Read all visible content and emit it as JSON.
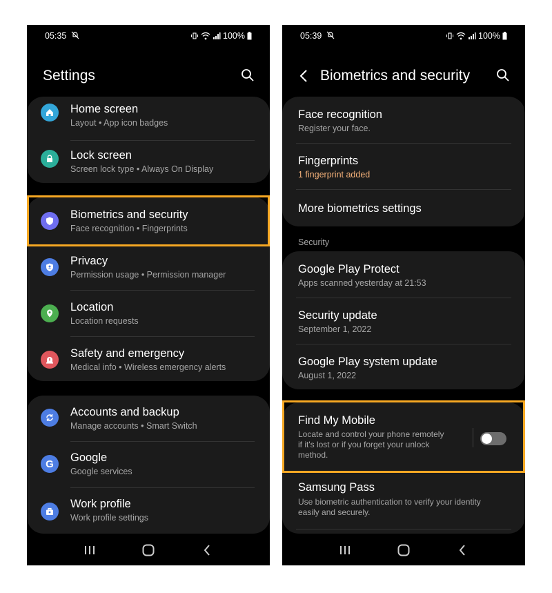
{
  "left": {
    "status": {
      "time": "05:35",
      "battery": "100%"
    },
    "title": "Settings",
    "groups": [
      [
        {
          "title": "Home screen",
          "subtitle": "Layout  •  App icon badges",
          "icon": "home-icon",
          "color": "#33a6d9"
        },
        {
          "title": "Lock screen",
          "subtitle": "Screen lock type  •  Always On Display",
          "icon": "lock-icon",
          "color": "#2bae9a"
        }
      ],
      [
        {
          "title": "Biometrics and security",
          "subtitle": "Face recognition  •  Fingerprints",
          "icon": "shield-icon",
          "color": "#6f6ef0"
        },
        {
          "title": "Privacy",
          "subtitle": "Permission usage  •  Permission manager",
          "icon": "privacy-icon",
          "color": "#4d7de3"
        },
        {
          "title": "Location",
          "subtitle": "Location requests",
          "icon": "location-pin-icon",
          "color": "#4caf50"
        },
        {
          "title": "Safety and emergency",
          "subtitle": "Medical info  •  Wireless emergency alerts",
          "icon": "emergency-icon",
          "color": "#e0575d"
        }
      ],
      [
        {
          "title": "Accounts and backup",
          "subtitle": "Manage accounts  •  Smart Switch",
          "icon": "sync-icon",
          "color": "#4d7de3"
        },
        {
          "title": "Google",
          "subtitle": "Google services",
          "icon": "google-icon",
          "color": "#4d7de3"
        },
        {
          "title": "Work profile",
          "subtitle": "Work profile settings",
          "icon": "briefcase-icon",
          "color": "#4d7de3"
        }
      ]
    ]
  },
  "right": {
    "status": {
      "time": "05:39",
      "battery": "100%"
    },
    "title": "Biometrics and security",
    "biometrics": [
      {
        "title": "Face recognition",
        "subtitle": "Register your face."
      },
      {
        "title": "Fingerprints",
        "subtitle": "1 fingerprint added"
      },
      {
        "title": "More biometrics settings"
      }
    ],
    "section_label": "Security",
    "security": [
      {
        "title": "Google Play Protect",
        "subtitle": "Apps scanned yesterday at 21:53"
      },
      {
        "title": "Security update",
        "subtitle": "September 1, 2022"
      },
      {
        "title": "Google Play system update",
        "subtitle": "August 1, 2022"
      }
    ],
    "find_my_mobile": {
      "title": "Find My Mobile",
      "line1": "Locate and control your phone remotely",
      "line2": "if it's lost or if you forget your unlock",
      "line3": "method.",
      "enabled": false
    },
    "samsung_pass": {
      "title": "Samsung Pass",
      "line1": "Use biometric authentication to verify your identity",
      "line2": "easily and securely."
    }
  },
  "colors": {
    "highlight": "#f7a823",
    "accent_subtitle": "#f6b27a",
    "card": "#1b1b1b"
  }
}
